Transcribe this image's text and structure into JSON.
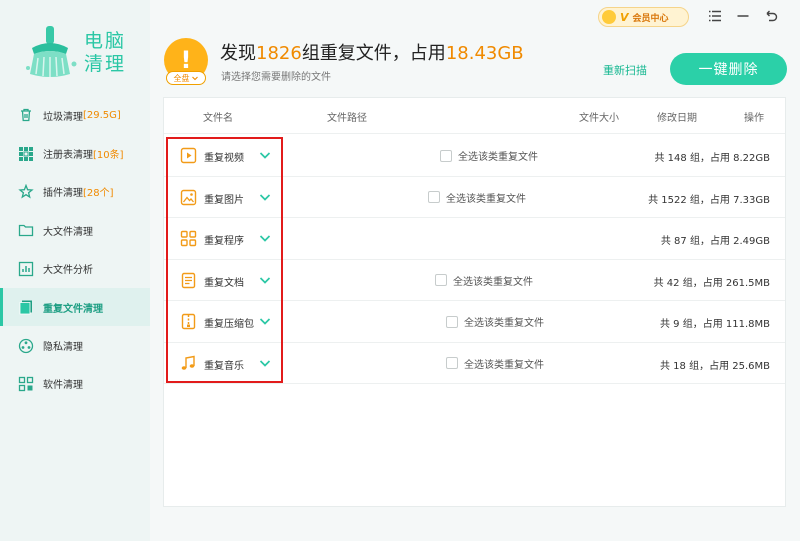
{
  "app": {
    "name_line1": "电脑",
    "name_line2": "清理"
  },
  "sidebar": {
    "items": [
      {
        "label": "垃圾清理",
        "badge": "[29.5G]",
        "icon": "trash-icon",
        "active": false
      },
      {
        "label": "注册表清理",
        "badge": "[10条]",
        "icon": "grid-icon",
        "active": false
      },
      {
        "label": "插件清理",
        "badge": "[28个]",
        "icon": "plugin-icon",
        "active": false
      },
      {
        "label": "大文件清理",
        "badge": "",
        "icon": "folder-icon",
        "active": false
      },
      {
        "label": "大文件分析",
        "badge": "",
        "icon": "chart-icon",
        "active": false
      },
      {
        "label": "重复文件清理",
        "badge": "",
        "icon": "duplicate-icon",
        "active": true
      },
      {
        "label": "隐私清理",
        "badge": "",
        "icon": "privacy-icon",
        "active": false
      },
      {
        "label": "软件清理",
        "badge": "",
        "icon": "apps-icon",
        "active": false
      }
    ]
  },
  "topbar": {
    "vip_label": "会员中心",
    "vip_v": "V"
  },
  "header": {
    "prefix": "发现",
    "count": "1826",
    "middle": "组重复文件，占用",
    "size": "18.43GB",
    "subtitle": "请选择您需要删除的文件",
    "scope_label": "全盘",
    "rescan_label": "重新扫描",
    "delete_label": "一键删除"
  },
  "table": {
    "columns": {
      "name": "文件名",
      "path": "文件路径",
      "size": "文件大小",
      "date": "修改日期",
      "action": "操作"
    },
    "rows": [
      {
        "name": "重复视频",
        "icon": "video-icon",
        "select_label": "全选该类重复文件",
        "summary": "共 148 组，占用 8.22GB"
      },
      {
        "name": "重复图片",
        "icon": "image-icon",
        "select_label": "全选该类重复文件",
        "summary": "共 1522 组，占用 7.33GB"
      },
      {
        "name": "重复程序",
        "icon": "program-icon",
        "select_label": "",
        "summary": "共 87 组，占用 2.49GB"
      },
      {
        "name": "重复文档",
        "icon": "document-icon",
        "select_label": "全选该类重复文件",
        "summary": "共 42 组，占用 261.5MB"
      },
      {
        "name": "重复压缩包",
        "icon": "archive-icon",
        "select_label": "全选该类重复文件",
        "summary": "共 9 组，占用 111.8MB"
      },
      {
        "name": "重复音乐",
        "icon": "music-icon",
        "select_label": "全选该类重复文件",
        "summary": "共 18 组，占用 25.6MB"
      }
    ]
  },
  "colors": {
    "accent": "#2bc7a5",
    "highlight": "#f08a00",
    "annotation": "#e21b1b"
  }
}
